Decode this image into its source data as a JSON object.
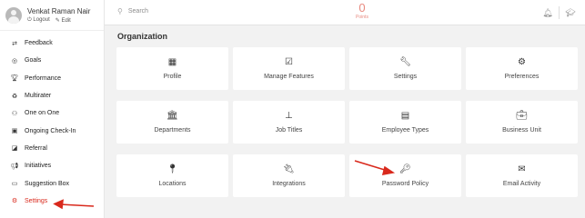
{
  "sidebar": {
    "profile": {
      "name": "Venkat Raman Nair",
      "logout": "Logout",
      "edit": "Edit"
    },
    "items": [
      {
        "label": "Feedback",
        "icon": "arrows-exchange-icon"
      },
      {
        "label": "Goals",
        "icon": "target-icon"
      },
      {
        "label": "Performance",
        "icon": "trophy-icon"
      },
      {
        "label": "Multirater",
        "icon": "recycle-icon"
      },
      {
        "label": "One on One",
        "icon": "people-icon"
      },
      {
        "label": "Ongoing Check-In",
        "icon": "calendar-check-icon"
      },
      {
        "label": "Referral",
        "icon": "referral-icon"
      },
      {
        "label": "Initiatives",
        "icon": "megaphone-icon"
      },
      {
        "label": "Suggestion Box",
        "icon": "laptop-icon"
      },
      {
        "label": "Settings",
        "icon": "gear-icon",
        "active": true
      }
    ]
  },
  "topbar": {
    "search_placeholder": "Search",
    "points_value": "0",
    "points_label": "Points"
  },
  "main": {
    "section_title": "Organization",
    "cards": [
      {
        "label": "Profile",
        "icon": "building-icon"
      },
      {
        "label": "Manage Features",
        "icon": "checkbox-icon"
      },
      {
        "label": "Settings",
        "icon": "wrench-icon"
      },
      {
        "label": "Preferences",
        "icon": "gears-icon"
      },
      {
        "label": "Departments",
        "icon": "institution-icon"
      },
      {
        "label": "Job Titles",
        "icon": "sitemap-icon"
      },
      {
        "label": "Employee Types",
        "icon": "id-card-icon"
      },
      {
        "label": "Business Unit",
        "icon": "briefcase-icon"
      },
      {
        "label": "Locations",
        "icon": "map-marker-icon"
      },
      {
        "label": "Integrations",
        "icon": "plug-icon"
      },
      {
        "label": "Password Policy",
        "icon": "key-icon"
      },
      {
        "label": "Email Activity",
        "icon": "envelope-icon"
      }
    ]
  },
  "colors": {
    "accent": "#d9291c",
    "points": "#e88a80",
    "background": "#f2f2f2"
  }
}
